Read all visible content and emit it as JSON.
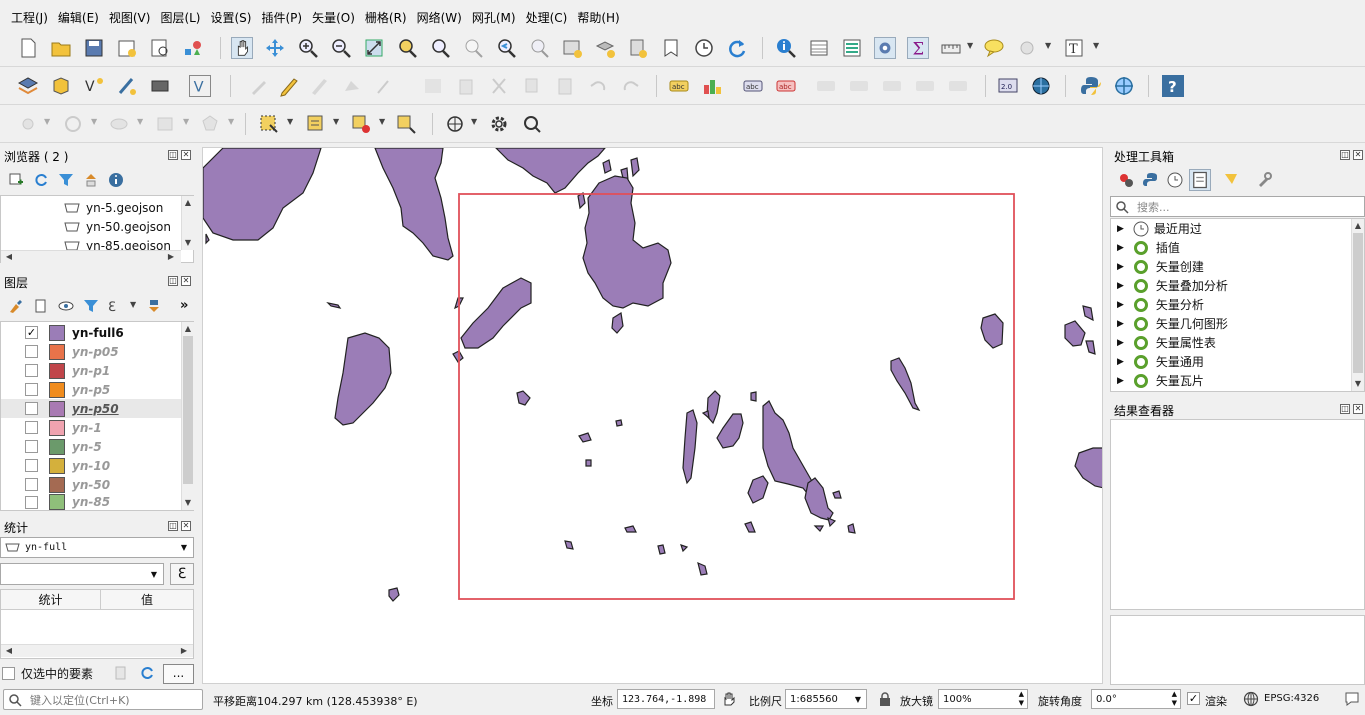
{
  "menu": [
    "工程(J)",
    "编辑(E)",
    "视图(V)",
    "图层(L)",
    "设置(S)",
    "插件(P)",
    "矢量(O)",
    "栅格(R)",
    "网络(W)",
    "网孔(M)",
    "处理(C)",
    "帮助(H)"
  ],
  "browser": {
    "title": "浏览器 ( 2 )",
    "items": [
      "yn-5.geojson",
      "yn-50.geojson",
      "yn-85.geojson"
    ]
  },
  "layers": {
    "title": "图层",
    "items": [
      {
        "name": "yn-full6",
        "checked": true,
        "color": "#9b7db7",
        "active": true
      },
      {
        "name": "yn-p05",
        "checked": false,
        "color": "#e8734a"
      },
      {
        "name": "yn-p1",
        "checked": false,
        "color": "#c0454a"
      },
      {
        "name": "yn-p5",
        "checked": false,
        "color": "#f08c1e"
      },
      {
        "name": "yn-p50",
        "checked": false,
        "color": "#a97ab3",
        "selected": true
      },
      {
        "name": "yn-1",
        "checked": false,
        "color": "#f0a3b0"
      },
      {
        "name": "yn-5",
        "checked": false,
        "color": "#6b9a6b"
      },
      {
        "name": "yn-10",
        "checked": false,
        "color": "#d4b03c"
      },
      {
        "name": "yn-50",
        "checked": false,
        "color": "#a46a52"
      },
      {
        "name": "yn-85",
        "checked": false,
        "color": "#8fbf7a"
      }
    ]
  },
  "stats": {
    "title": "统计",
    "layer": "yn-full",
    "expression": "",
    "col_stat": "统计",
    "col_value": "值",
    "only_selected": "仅选中的要素",
    "more": "..."
  },
  "processing": {
    "title": "处理工具箱",
    "search_placeholder": "搜索...",
    "items": [
      "最近用过",
      "插值",
      "矢量创建",
      "矢量叠加分析",
      "矢量分析",
      "矢量几何图形",
      "矢量属性表",
      "矢量通用",
      "矢量瓦片"
    ]
  },
  "results": {
    "title": "结果查看器"
  },
  "statusbar": {
    "locate_placeholder": "键入以定位(Ctrl+K)",
    "message": "平移距离104.297 km (128.453938° E)",
    "coord_label": "坐标",
    "coord_value": "123.764,-1.898",
    "scale_label": "比例尺",
    "scale_value": "1:685560",
    "magnifier_label": "放大镜",
    "magnifier_value": "100%",
    "rotation_label": "旋转角度",
    "rotation_value": "0.0°",
    "render_label": "渲染",
    "crs": "EPSG:4326"
  },
  "colors": {
    "feature_fill": "#9b7db7",
    "feature_stroke": "#222222",
    "extent_box": "#e0505a"
  }
}
